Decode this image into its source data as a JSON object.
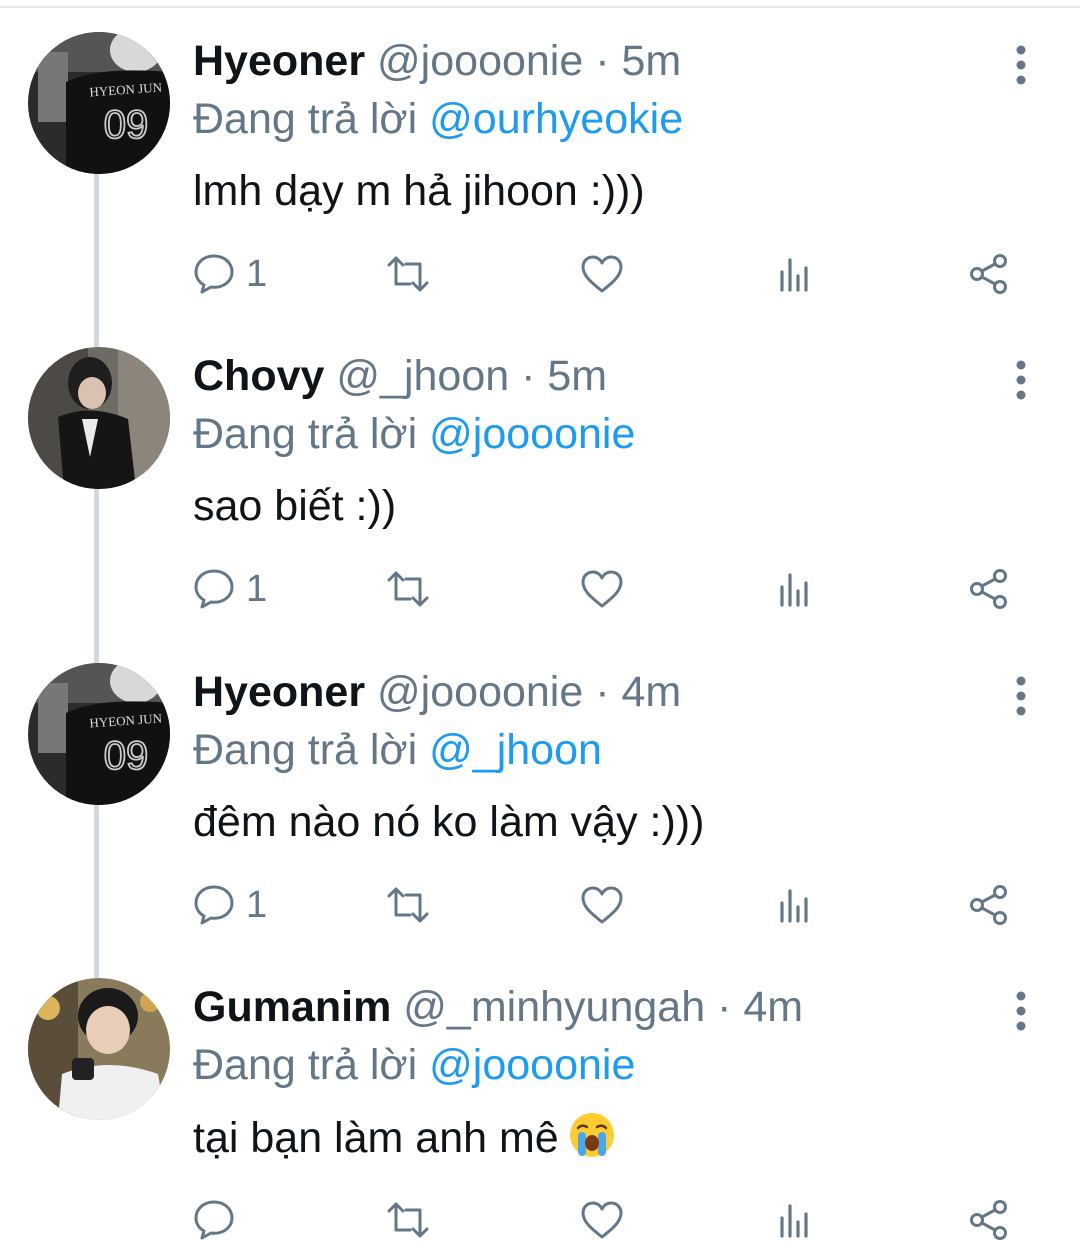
{
  "tweets": [
    {
      "name": "Hyeoner",
      "handle": "@joooonie",
      "sep": "·",
      "time": "5m",
      "reply_prefix": "Đang trả lời",
      "reply_to": "@ourhyeokie",
      "text": "lmh dạy m hả jihoon :)))",
      "reply_count": "1",
      "avatar_jersey_name": "HYEON JUN",
      "avatar_jersey_number": "09"
    },
    {
      "name": "Chovy",
      "handle": "@_jhoon",
      "sep": "·",
      "time": "5m",
      "reply_prefix": "Đang trả lời",
      "reply_to": "@joooonie",
      "text": "sao biết :))",
      "reply_count": "1"
    },
    {
      "name": "Hyeoner",
      "handle": "@joooonie",
      "sep": "·",
      "time": "4m",
      "reply_prefix": "Đang trả lời",
      "reply_to": "@_jhoon",
      "text": "đêm nào nó ko làm vậy :)))",
      "reply_count": "1",
      "avatar_jersey_name": "HYEON JUN",
      "avatar_jersey_number": "09"
    },
    {
      "name": "Gumanim",
      "handle": "@_minhyungah",
      "sep": "·",
      "time": "4m",
      "reply_prefix": "Đang trả lời",
      "reply_to": "@joooonie",
      "text": "tại bạn làm anh mê",
      "reply_count": "",
      "emoji": "loudly-crying-face"
    }
  ],
  "icons": {
    "reply": "reply-icon",
    "retweet": "retweet-icon",
    "like": "heart-icon",
    "analytics": "analytics-icon",
    "share": "share-icon",
    "more": "more-vertical-icon"
  },
  "colors": {
    "name": "#0f1419",
    "secondary": "#657786",
    "mention": "#1d9bf0",
    "thread_line": "#cfd9de"
  }
}
